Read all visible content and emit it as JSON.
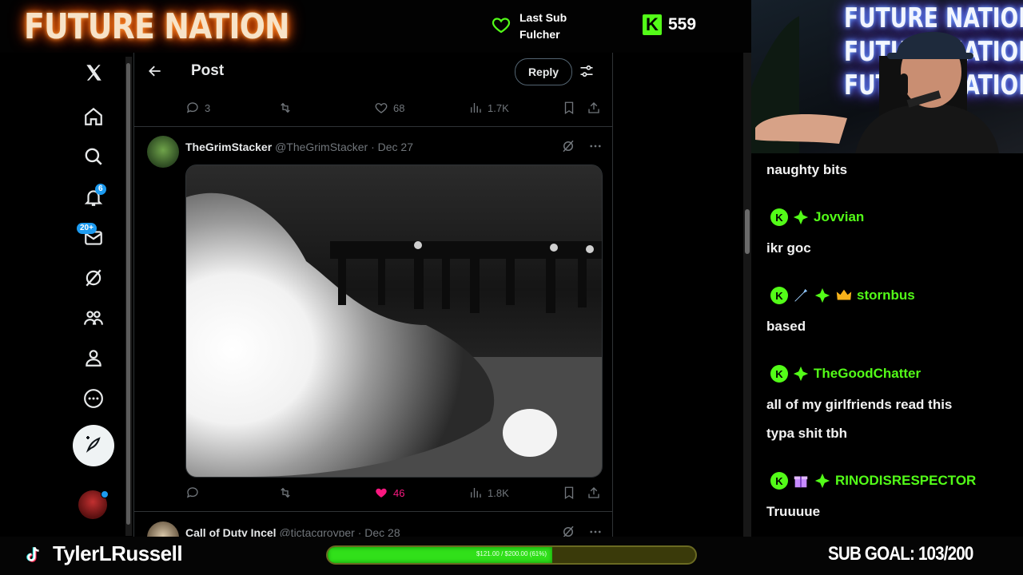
{
  "overlay": {
    "logo_text": "FUTURE NATION",
    "last_sub_label": "Last Sub",
    "last_sub_name": "Fulcher",
    "kick_icon": "K",
    "kick_viewers": "559",
    "channel_name": "TylerLRussell",
    "sub_goal_text": "SUB GOAL: 103/200",
    "progress_text": "$121.00 / $200.00 (61%)",
    "progress_fraction": 0.61,
    "webcam_sign": [
      "FUTURE NATION",
      "FUTURE NATION",
      "FUTURE NATION"
    ],
    "accent_color": "#53fc18"
  },
  "x": {
    "nav_icons": [
      "x-logo-icon",
      "home-icon",
      "search-icon",
      "notifications-icon",
      "messages-icon",
      "grok-icon",
      "communities-icon",
      "profile-icon",
      "more-icon",
      "compose-post-icon"
    ],
    "notifications_badge": "6",
    "messages_badge": "20+",
    "header_title": "Post",
    "reply_button_label": "Reply",
    "top_actions": {
      "replies": "3",
      "likes": "68",
      "views": "1.7K"
    },
    "tweets": [
      {
        "display_name": "TheGrimStacker",
        "handle": "@TheGrimStacker",
        "date": "· Dec 27",
        "replies": "",
        "likes": "46",
        "liked": true,
        "views": "1.8K"
      },
      {
        "display_name": "Call of Duty Incel",
        "handle": "@tictacgroyper",
        "date": "· Dec 28"
      }
    ],
    "like_color": "#f91880"
  },
  "chat": {
    "messages": [
      {
        "text": "naughty bits"
      },
      {
        "user": "Jovvian",
        "badges": [
          "kick-badge",
          "green-gem-badge"
        ],
        "text": "ikr goc"
      },
      {
        "user": "stornbus",
        "badges": [
          "kick-badge",
          "sword-badge",
          "green-gem-badge",
          "crown-badge"
        ],
        "text": "based"
      },
      {
        "user": "TheGoodChatter",
        "badges": [
          "kick-badge",
          "green-gem-badge"
        ],
        "text": "all of my girlfriends read this",
        "text2": "typa shit tbh"
      },
      {
        "user": "RINODISRESPECTOR",
        "badges": [
          "kick-badge",
          "gift-badge",
          "green-gem-badge"
        ],
        "text": "Truuuue"
      }
    ],
    "username_color": "#53fc18"
  }
}
